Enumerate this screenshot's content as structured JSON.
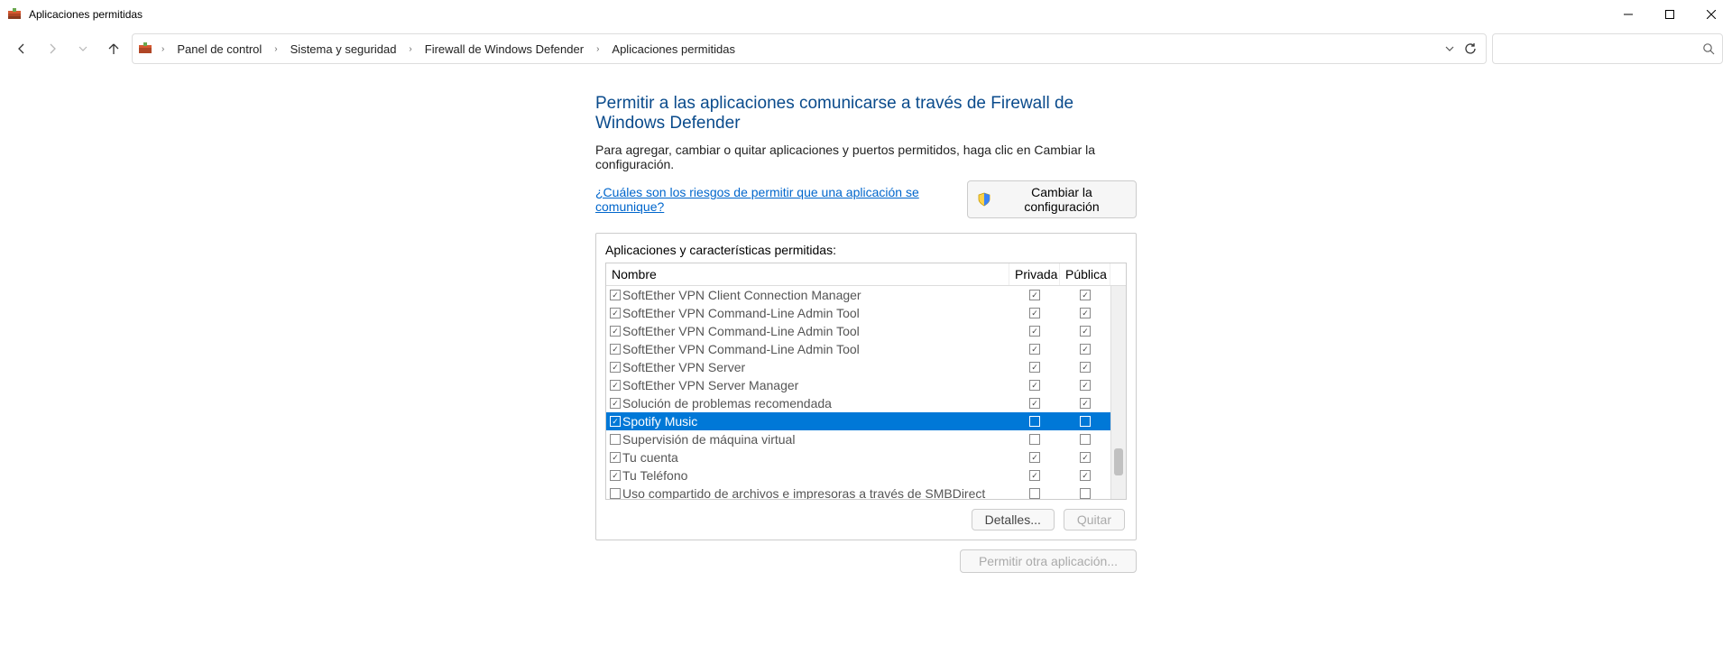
{
  "window": {
    "title": "Aplicaciones permitidas"
  },
  "breadcrumb": {
    "items": [
      "Panel de control",
      "Sistema y seguridad",
      "Firewall de Windows Defender",
      "Aplicaciones permitidas"
    ]
  },
  "page": {
    "heading": "Permitir a las aplicaciones comunicarse a través de Firewall de Windows Defender",
    "subtext": "Para agregar, cambiar o quitar aplicaciones y puertos permitidos, haga clic en Cambiar la configuración.",
    "risk_link": "¿Cuáles son los riesgos de permitir que una aplicación se comunique?",
    "change_settings": "Cambiar la configuración",
    "group_label": "Aplicaciones y características permitidas:",
    "columns": {
      "name": "Nombre",
      "private": "Privada",
      "public": "Pública"
    },
    "details_btn": "Detalles...",
    "remove_btn": "Quitar",
    "allow_another_btn": "Permitir otra aplicación..."
  },
  "rows": [
    {
      "enabled": true,
      "name": "SoftEther VPN Client Connection Manager",
      "private": true,
      "public": true,
      "selected": false
    },
    {
      "enabled": true,
      "name": "SoftEther VPN Command-Line Admin Tool",
      "private": true,
      "public": true,
      "selected": false
    },
    {
      "enabled": true,
      "name": "SoftEther VPN Command-Line Admin Tool",
      "private": true,
      "public": true,
      "selected": false
    },
    {
      "enabled": true,
      "name": "SoftEther VPN Command-Line Admin Tool",
      "private": true,
      "public": true,
      "selected": false
    },
    {
      "enabled": true,
      "name": "SoftEther VPN Server",
      "private": true,
      "public": true,
      "selected": false
    },
    {
      "enabled": true,
      "name": "SoftEther VPN Server Manager",
      "private": true,
      "public": true,
      "selected": false
    },
    {
      "enabled": true,
      "name": "Solución de problemas recomendada",
      "private": true,
      "public": true,
      "selected": false
    },
    {
      "enabled": true,
      "name": "Spotify Music",
      "private": false,
      "public": false,
      "selected": true
    },
    {
      "enabled": false,
      "name": "Supervisión de máquina virtual",
      "private": false,
      "public": false,
      "selected": false
    },
    {
      "enabled": true,
      "name": "Tu cuenta",
      "private": true,
      "public": true,
      "selected": false
    },
    {
      "enabled": true,
      "name": "Tu Teléfono",
      "private": true,
      "public": true,
      "selected": false
    },
    {
      "enabled": false,
      "name": "Uso compartido de archivos e impresoras a través de SMBDirect",
      "private": false,
      "public": false,
      "selected": false
    }
  ]
}
